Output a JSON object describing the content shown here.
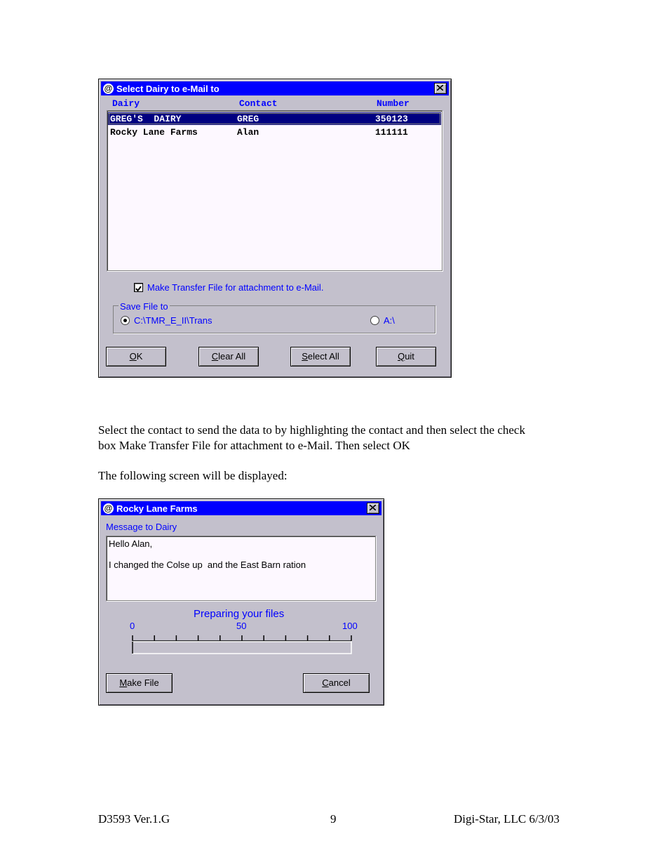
{
  "dialog1": {
    "title": "Select Dairy to e-Mail to",
    "columns": {
      "dairy": "Dairy",
      "contact": "Contact",
      "number": "Number"
    },
    "rows": [
      {
        "dairy": "GREG'S  DAIRY",
        "contact": "GREG",
        "number": "350123"
      },
      {
        "dairy": "Rocky Lane Farms",
        "contact": "Alan",
        "number": "111111"
      }
    ],
    "selected_row": 0,
    "checkbox_label": "Make Transfer File for attachment to e-Mail.",
    "checkbox_checked": true,
    "group_label": "Save File to",
    "radio1_label": "C:\\TMR_E_II\\Trans",
    "radio2_label": "A:\\",
    "buttons": {
      "ok": {
        "key": "O",
        "rest": "K"
      },
      "clear_all": {
        "key": "C",
        "rest": "lear All"
      },
      "select_all": {
        "key": "S",
        "rest": "elect All"
      },
      "quit": {
        "key": "Q",
        "rest": "uit"
      }
    }
  },
  "text": {
    "para1_line1": "Select the contact to send the data to by highlighting the contact and then select the check",
    "para1_line2": "box Make Transfer File for attachment to e-Mail. Then select OK",
    "para2": "The following screen will be displayed:"
  },
  "dialog2": {
    "title": "Rocky Lane Farms",
    "message_label": "Message to Dairy",
    "message_line1": "Hello Alan,",
    "message_line2": "I changed the Colse up  and the East Barn ration",
    "progress_label": "Preparing your files",
    "scale_min": "0",
    "scale_mid": "50",
    "scale_max": "100",
    "progress_value": 0,
    "buttons": {
      "make_file": {
        "key": "M",
        "rest": "ake File"
      },
      "cancel": {
        "key": "C",
        "rest": "ancel"
      }
    }
  },
  "footer": {
    "left": "D3593  Ver.1.G",
    "center": "9",
    "right": "Digi-Star, LLC 6/3/03"
  }
}
